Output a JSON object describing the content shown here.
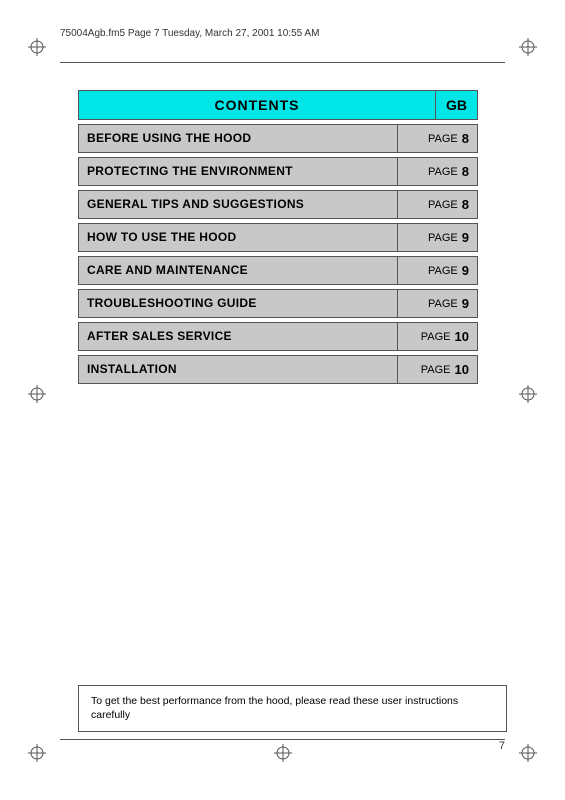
{
  "header": {
    "text": "75004Agb.fm5  Page 7  Tuesday, March 27, 2001  10:55 AM"
  },
  "contents": {
    "title": "CONTENTS",
    "gb_label": "GB"
  },
  "toc_items": [
    {
      "title": "BEFORE USING THE HOOD",
      "page_label": "PAGE",
      "page_num": "8"
    },
    {
      "title": "PROTECTING THE ENVIRONMENT",
      "page_label": "PAGE",
      "page_num": "8"
    },
    {
      "title": "GENERAL TIPS AND SUGGESTIONS",
      "page_label": "PAGE",
      "page_num": "8"
    },
    {
      "title": "HOW TO USE THE HOOD",
      "page_label": "PAGE",
      "page_num": "9"
    },
    {
      "title": "CARE AND MAINTENANCE",
      "page_label": "PAGE",
      "page_num": "9"
    },
    {
      "title": "TROUBLESHOOTING GUIDE",
      "page_label": "PAGE",
      "page_num": "9"
    },
    {
      "title": "AFTER SALES SERVICE",
      "page_label": "PAGE",
      "page_num": "10"
    },
    {
      "title": "INSTALLATION",
      "page_label": "PAGE",
      "page_num": "10"
    }
  ],
  "bottom_note": "To get the best performance from the hood, please read these user instructions carefully",
  "page_number": "7"
}
